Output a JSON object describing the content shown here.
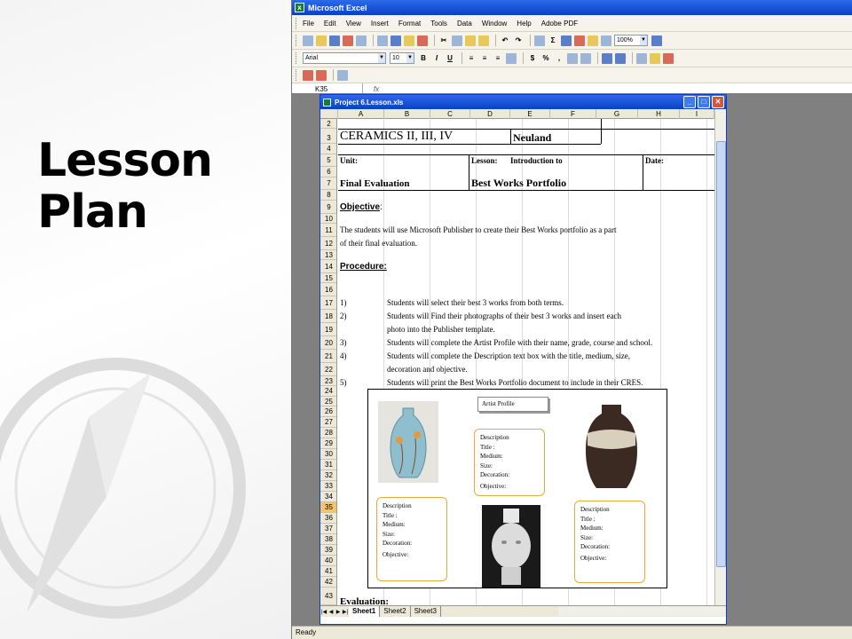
{
  "slide": {
    "title_line1": "Lesson",
    "title_line2": "Plan"
  },
  "excel": {
    "app_title": "Microsoft Excel",
    "menu": [
      "File",
      "Edit",
      "View",
      "Insert",
      "Format",
      "Tools",
      "Data",
      "Window",
      "Help",
      "Adobe PDF"
    ],
    "zoom": "100%",
    "font": "Arial",
    "font_size": "10",
    "name_box": "K35",
    "fx": "fx",
    "workbook_title": "Project 6.Lesson.xls",
    "columns": [
      "A",
      "B",
      "C",
      "D",
      "E",
      "F",
      "G",
      "H",
      "I"
    ],
    "rows": [
      "2",
      "3",
      "4",
      "5",
      "6",
      "7",
      "8",
      "9",
      "10",
      "11",
      "12",
      "13",
      "14",
      "15",
      "16",
      "17",
      "18",
      "19",
      "20",
      "21",
      "22",
      "23",
      "24",
      "25",
      "26",
      "27",
      "28",
      "29",
      "30",
      "31",
      "32",
      "33",
      "34",
      "35",
      "36",
      "37",
      "38",
      "39",
      "40",
      "41",
      "42",
      "43"
    ],
    "selected_row": "35",
    "sheet": {
      "course": "CERAMICS II, III, IV",
      "teacher": "Neuland",
      "unit_label": "Unit:",
      "lesson_label": "Lesson:",
      "lesson_value": "Introduction to",
      "date_label": "Date:",
      "unit_value": "Final Evaluation",
      "lesson_value2": "Best Works Portfolio",
      "objective_label": "Objective",
      "objective_colon": ":",
      "objective_line1": "The students will use Microsoft Publisher to create their Best Works portfolio as a part",
      "objective_line2": "of their final evaluation.",
      "procedure_label": "Procedure:",
      "steps": [
        {
          "num": "1)",
          "text": "Students will select their best 3 works from both terms."
        },
        {
          "num": "2)",
          "text": "Students will Find their photographs of their best 3 works and insert each"
        },
        {
          "num": "",
          "text": "photo into the Publisher template."
        },
        {
          "num": "3)",
          "text": "Students will complete the Artist Profile with their name, grade, course and school."
        },
        {
          "num": "4)",
          "text": "Students will complete the Description text box with the title, medium, size,"
        },
        {
          "num": "",
          "text": "decoration and objective."
        },
        {
          "num": "5)",
          "text": "Students will print the Best Works Portfolio document to include in their CRES."
        }
      ],
      "evaluation_label": "Evaluation:"
    },
    "publisher": {
      "artist_profile": "Artist Profile",
      "desc_lines": [
        "Description",
        "Title :",
        "Medium:",
        "Size:",
        "Decoration:"
      ],
      "objective": "Objective:"
    },
    "tabs": [
      "Sheet1",
      "Sheet2",
      "Sheet3"
    ],
    "status": "Ready"
  }
}
